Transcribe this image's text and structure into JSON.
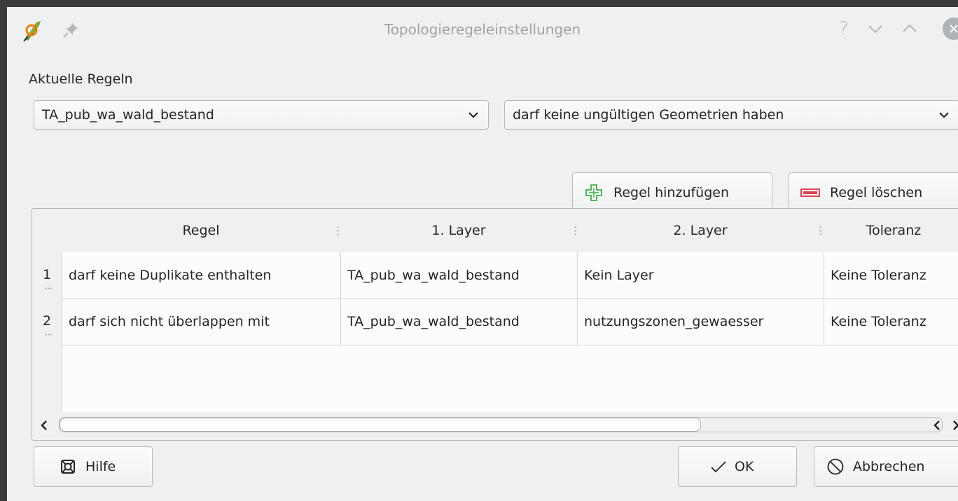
{
  "window": {
    "title": "Topologieregeleinstellungen",
    "help_glyph": "?",
    "app_icon": "qgis-logo-icon",
    "pin_icon": "pin-icon"
  },
  "rules_label": "Aktuelle Regeln",
  "layer_combo": {
    "value": "TA_pub_wa_wald_bestand"
  },
  "rule_combo": {
    "value": "darf keine ungültigen Geometrien haben"
  },
  "buttons": {
    "add_rule": "Regel hinzufügen",
    "delete_rule": "Regel löschen",
    "help": "Hilfe",
    "ok": "OK",
    "cancel": "Abbrechen"
  },
  "table": {
    "columns": [
      "Regel",
      "1. Layer",
      "2. Layer",
      "Toleranz"
    ],
    "rows": [
      {
        "num": "1",
        "rule": "darf keine Duplikate enthalten",
        "layer1": "TA_pub_wa_wald_bestand",
        "layer2": "Kein Layer",
        "tolerance": "Keine Toleranz"
      },
      {
        "num": "2",
        "rule": "darf sich nicht überlappen mit",
        "layer1": "TA_pub_wa_wald_bestand",
        "layer2": "nutzungszonen_gewaesser",
        "tolerance": "Keine Toleranz"
      }
    ]
  },
  "colors": {
    "add_icon": "#3daf49",
    "delete_icon": "#da4453",
    "window_bg": "#eff0f1"
  }
}
